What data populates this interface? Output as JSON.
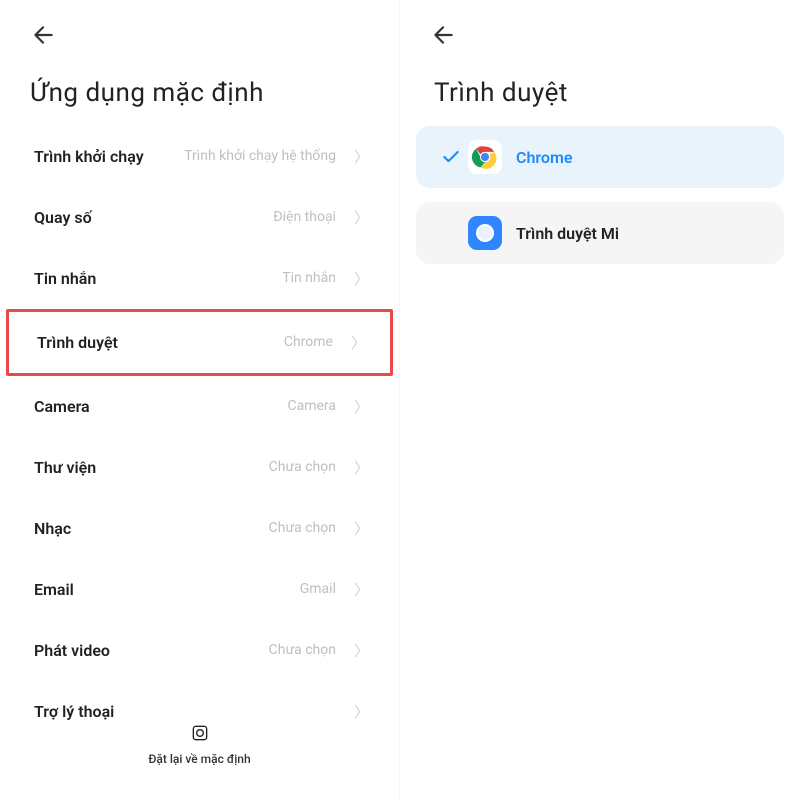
{
  "left": {
    "title": "Ứng dụng mặc định",
    "rows": [
      {
        "label": "Trình khởi chạy",
        "value": "Trình khởi chạy hệ thống"
      },
      {
        "label": "Quay số",
        "value": "Điện thoại"
      },
      {
        "label": "Tin nhắn",
        "value": "Tin nhắn"
      },
      {
        "label": "Trình duyệt",
        "value": "Chrome"
      },
      {
        "label": "Camera",
        "value": "Camera"
      },
      {
        "label": "Thư viện",
        "value": "Chưa chọn"
      },
      {
        "label": "Nhạc",
        "value": "Chưa chọn"
      },
      {
        "label": "Email",
        "value": "Gmail"
      },
      {
        "label": "Phát video",
        "value": "Chưa chọn"
      },
      {
        "label": "Trợ lý thoại",
        "value": ""
      }
    ],
    "reset_label": "Đặt lại về mặc định"
  },
  "right": {
    "title": "Trình duyệt",
    "options": [
      {
        "label": "Chrome"
      },
      {
        "label": "Trình duyệt Mi"
      }
    ]
  }
}
